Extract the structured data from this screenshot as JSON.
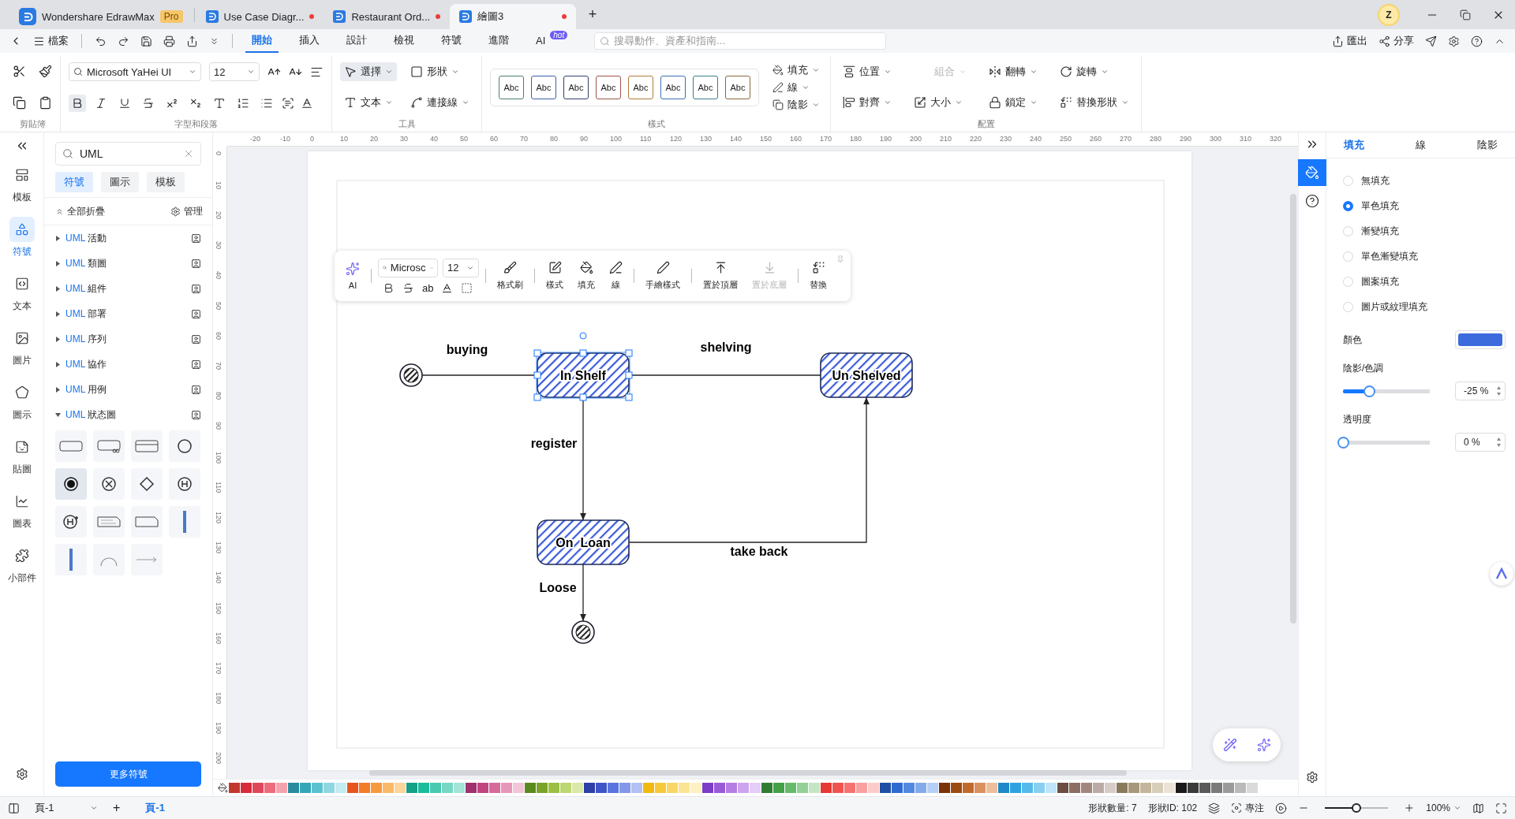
{
  "app_tabs": [
    {
      "label": "Wondershare EdrawMax",
      "kind": "home",
      "badge": "Pro",
      "selected": false
    },
    {
      "label": "Use Case Diagr...",
      "kind": "doc",
      "selected": false,
      "unsaved": true
    },
    {
      "label": "Restaurant Ord...",
      "kind": "doc",
      "selected": false,
      "unsaved": true
    },
    {
      "label": "繪圖3",
      "kind": "doc",
      "selected": true,
      "unsaved": true
    }
  ],
  "new_tab": "+",
  "avatar": "Z",
  "file_menu": "檔案",
  "menu_tabs": [
    {
      "label": "開始",
      "selected": true
    },
    {
      "label": "插入",
      "selected": false
    },
    {
      "label": "設計",
      "selected": false
    },
    {
      "label": "檢視",
      "selected": false
    },
    {
      "label": "符號",
      "selected": false
    },
    {
      "label": "進階",
      "selected": false
    },
    {
      "label": "AI",
      "selected": false,
      "badge": "hot"
    }
  ],
  "search": {
    "placeholder": "搜尋動作、資產和指南..."
  },
  "top_actions": [
    "匯出",
    "分享"
  ],
  "ribbon": {
    "clipboard": {
      "title": "剪貼簿"
    },
    "font": {
      "title": "字型和段落",
      "family": "Microsoft YaHei UI",
      "size": "12"
    },
    "tools": {
      "title": "工具",
      "items": [
        {
          "label": "選擇",
          "selected": true
        },
        {
          "label": "形狀",
          "selected": false
        },
        {
          "label": "文本",
          "selected": false
        },
        {
          "label": "連接線",
          "selected": false
        }
      ]
    },
    "styles": {
      "title": "樣式",
      "swatches": [
        {
          "label": "Abc",
          "color": "#4f7f6e"
        },
        {
          "label": "Abc",
          "color": "#3f5fa8"
        },
        {
          "label": "Abc",
          "color": "#34406e"
        },
        {
          "label": "Abc",
          "color": "#a0524a"
        },
        {
          "label": "Abc",
          "color": "#b07a3c"
        },
        {
          "label": "Abc",
          "color": "#3d6fb8"
        },
        {
          "label": "Abc",
          "color": "#3b7d8c"
        },
        {
          "label": "Abc",
          "color": "#8a6a3c"
        }
      ],
      "options": [
        "填充",
        "線",
        "陰影"
      ]
    },
    "arrange": {
      "title": "配置",
      "items": [
        {
          "label": "位置",
          "disabled": false
        },
        {
          "label": "組合",
          "disabled": true
        },
        {
          "label": "翻轉",
          "disabled": false
        },
        {
          "label": "旋轉",
          "disabled": false
        },
        {
          "label": "對齊",
          "disabled": false
        },
        {
          "label": "大小",
          "disabled": false
        },
        {
          "label": "鎖定",
          "disabled": false
        },
        {
          "label": "替換形狀",
          "disabled": false
        }
      ]
    }
  },
  "left_rail": [
    {
      "label": "模板",
      "selected": false
    },
    {
      "label": "符號",
      "selected": true
    },
    {
      "label": "文本",
      "selected": false
    },
    {
      "label": "圖片",
      "selected": false
    },
    {
      "label": "圖示",
      "selected": false
    },
    {
      "label": "貼圖",
      "selected": false
    },
    {
      "label": "圖表",
      "selected": false
    },
    {
      "label": "小部件",
      "selected": false
    }
  ],
  "library": {
    "search": "UML",
    "tabs": [
      {
        "label": "符號",
        "selected": true
      },
      {
        "label": "圖示",
        "selected": false
      },
      {
        "label": "模板",
        "selected": false
      }
    ],
    "collapse_all": "全部折疊",
    "manage": "管理",
    "categories": [
      {
        "prefix": "UML",
        "name": "活動",
        "expanded": false
      },
      {
        "prefix": "UML",
        "name": "類圖",
        "expanded": false
      },
      {
        "prefix": "UML",
        "name": "組件",
        "expanded": false
      },
      {
        "prefix": "UML",
        "name": "部署",
        "expanded": false
      },
      {
        "prefix": "UML",
        "name": "序列",
        "expanded": false
      },
      {
        "prefix": "UML",
        "name": "協作",
        "expanded": false
      },
      {
        "prefix": "UML",
        "name": "用例",
        "expanded": false
      },
      {
        "prefix": "UML",
        "name": "狀态圖",
        "expanded": true
      }
    ],
    "shapes": [
      {
        "kind": "state",
        "selected": false
      },
      {
        "kind": "state-sub",
        "selected": false
      },
      {
        "kind": "state-activities",
        "selected": false
      },
      {
        "kind": "circle",
        "selected": false
      },
      {
        "kind": "initial",
        "selected": true
      },
      {
        "kind": "final",
        "selected": false
      },
      {
        "kind": "choice",
        "selected": false
      },
      {
        "kind": "history",
        "selected": false
      },
      {
        "kind": "deep-history",
        "selected": false
      },
      {
        "kind": "note-lines",
        "selected": false
      },
      {
        "kind": "note",
        "selected": false
      },
      {
        "kind": "bar",
        "selected": false
      },
      {
        "kind": "bar",
        "selected": false
      },
      {
        "kind": "self-loop",
        "selected": false
      },
      {
        "kind": "arrow",
        "selected": false
      }
    ],
    "more_button": "更多符號"
  },
  "rulers": {
    "horizontal": [
      "-20",
      "-10",
      "0",
      "10",
      "20",
      "30",
      "40",
      "50",
      "60",
      "70",
      "80",
      "90",
      "100",
      "110",
      "120",
      "130",
      "140",
      "150",
      "160",
      "170",
      "180",
      "190",
      "200",
      "210",
      "220",
      "230",
      "240",
      "250",
      "260",
      "270",
      "280",
      "290",
      "300",
      "310",
      "320"
    ],
    "vertical": [
      "0",
      "10",
      "20",
      "30",
      "40",
      "50",
      "60",
      "70",
      "80",
      "90",
      "100",
      "110",
      "120",
      "130",
      "140",
      "150",
      "160",
      "170",
      "180",
      "190",
      "200"
    ]
  },
  "float_toolbar": {
    "ai": "AI",
    "font": "Microsc",
    "size": "12",
    "format_text": "ab",
    "buttons": [
      {
        "label": "格式刷",
        "disabled": false
      },
      {
        "label": "樣式",
        "disabled": false
      },
      {
        "label": "填充",
        "disabled": false
      },
      {
        "label": "線",
        "disabled": false
      },
      {
        "label": "手繪樣式",
        "disabled": false
      },
      {
        "label": "置於頂層",
        "disabled": false
      },
      {
        "label": "置於底層",
        "disabled": true
      },
      {
        "label": "替換",
        "disabled": false
      }
    ]
  },
  "diagram": {
    "nodes": [
      {
        "kind": "initial"
      },
      {
        "kind": "state",
        "label": "In Shelf",
        "selected": true
      },
      {
        "kind": "state",
        "label": "Un Shelved",
        "selected": false
      },
      {
        "kind": "state",
        "label": "On  Loan",
        "selected": false
      },
      {
        "kind": "final"
      }
    ],
    "edges": [
      {
        "label": "buying"
      },
      {
        "label": "shelving"
      },
      {
        "label": "register"
      },
      {
        "label": "take back"
      },
      {
        "label": "Loose"
      }
    ]
  },
  "right_panel": {
    "tabs": [
      {
        "label": "填充",
        "selected": true
      },
      {
        "label": "線",
        "selected": false
      },
      {
        "label": "陰影",
        "selected": false
      }
    ],
    "fill_options": [
      {
        "label": "無填充",
        "selected": false
      },
      {
        "label": "單色填充",
        "selected": true
      },
      {
        "label": "漸變填充",
        "selected": false
      },
      {
        "label": "單色漸變填充",
        "selected": false
      },
      {
        "label": "圖案填充",
        "selected": false
      },
      {
        "label": "圖片或紋理填充",
        "selected": false
      }
    ],
    "color_label": "顏色",
    "color": "#3b6bdc",
    "shade": {
      "label": "陰影/色調",
      "level": 0.3,
      "value": "-25 %"
    },
    "opacity": {
      "label": "透明度",
      "level": 0,
      "value": "0 %"
    }
  },
  "palette": [
    {
      "color": "#c0392b"
    },
    {
      "color": "#d62c3c"
    },
    {
      "color": "#e0475a"
    },
    {
      "color": "#ee6b7b"
    },
    {
      "color": "#f4a3ad"
    },
    {
      "color": "#2a8c9c"
    },
    {
      "color": "#34a7b8"
    },
    {
      "color": "#5cc2d0"
    },
    {
      "color": "#8fd7e0"
    },
    {
      "color": "#c4ebf0"
    },
    {
      "color": "#e8541e"
    },
    {
      "color": "#f47b2a"
    },
    {
      "color": "#f79a3e"
    },
    {
      "color": "#fab968"
    },
    {
      "color": "#fcd59c"
    },
    {
      "color": "#16a085"
    },
    {
      "color": "#1abc9c"
    },
    {
      "color": "#48c9b0"
    },
    {
      "color": "#76d7c4"
    },
    {
      "color": "#a3e4d7"
    },
    {
      "color": "#a0306e"
    },
    {
      "color": "#c0457f"
    },
    {
      "color": "#d66a9b"
    },
    {
      "color": "#e697b9"
    },
    {
      "color": "#f3c5d8"
    },
    {
      "color": "#5a8a1e"
    },
    {
      "color": "#7aa329"
    },
    {
      "color": "#9bbf45"
    },
    {
      "color": "#bcd672"
    },
    {
      "color": "#dae8a8"
    },
    {
      "color": "#2e3fa8"
    },
    {
      "color": "#3d55c8"
    },
    {
      "color": "#5a74dd"
    },
    {
      "color": "#8297e8"
    },
    {
      "color": "#b2c0f2"
    },
    {
      "color": "#f1b90f"
    },
    {
      "color": "#f6c93a"
    },
    {
      "color": "#f9d766"
    },
    {
      "color": "#fbe493"
    },
    {
      "color": "#fdf0c2"
    },
    {
      "color": "#7d3cc8"
    },
    {
      "color": "#9a5ad8"
    },
    {
      "color": "#b47ee3"
    },
    {
      "color": "#cda4ee"
    },
    {
      "color": "#e4cdf6"
    },
    {
      "color": "#2e7d32"
    },
    {
      "color": "#43a047"
    },
    {
      "color": "#66bb6a"
    },
    {
      "color": "#93d196"
    },
    {
      "color": "#c3e6c4"
    },
    {
      "color": "#e53935"
    },
    {
      "color": "#ef5350"
    },
    {
      "color": "#f47370"
    },
    {
      "color": "#f8a09e"
    },
    {
      "color": "#fbcbc9"
    },
    {
      "color": "#1f4fa3"
    },
    {
      "color": "#2e6bd1"
    },
    {
      "color": "#5289e0"
    },
    {
      "color": "#82abea"
    },
    {
      "color": "#b7cff4"
    },
    {
      "color": "#7a3208"
    },
    {
      "color": "#9c4a14"
    },
    {
      "color": "#c06a2e"
    },
    {
      "color": "#d9915f"
    },
    {
      "color": "#ecbe9c"
    },
    {
      "color": "#1e88c8"
    },
    {
      "color": "#2ea3e0"
    },
    {
      "color": "#55b9ea"
    },
    {
      "color": "#86cff1"
    },
    {
      "color": "#bde4f8"
    },
    {
      "color": "#6d4c41"
    },
    {
      "color": "#8d6e63"
    },
    {
      "color": "#a1887f"
    },
    {
      "color": "#bcaaa4"
    },
    {
      "color": "#d7ccc8"
    },
    {
      "color": "#8a7a5c"
    },
    {
      "color": "#a8977a"
    },
    {
      "color": "#c2b59c"
    },
    {
      "color": "#d8cdb9"
    },
    {
      "color": "#ebe4d6"
    },
    {
      "color": "#1a1a1a"
    },
    {
      "color": "#3a3a3a"
    },
    {
      "color": "#5a5a5a"
    },
    {
      "color": "#7a7a7a"
    },
    {
      "color": "#9a9a9a"
    },
    {
      "color": "#bababa"
    },
    {
      "color": "#dadada"
    }
  ],
  "status_bar": {
    "page_select": "頁-1",
    "add": "+",
    "pages": [
      {
        "label": "頁-1",
        "selected": true
      }
    ],
    "shape_count": "形狀數量: 7",
    "shape_id": "形狀ID: 102",
    "focus": "專注",
    "zoom": {
      "level": 0.5,
      "value": "100%"
    }
  }
}
